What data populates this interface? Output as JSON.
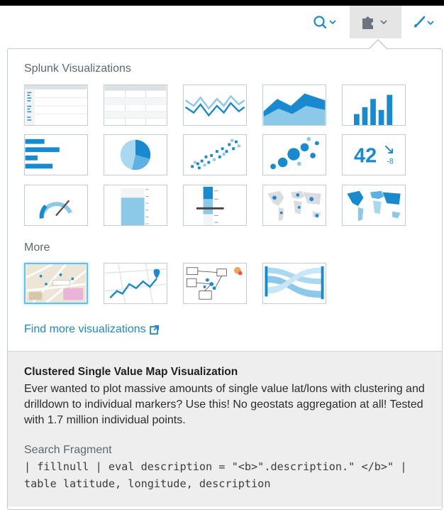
{
  "toolbar": {
    "search_icon": "search-icon",
    "viz_icon": "puzzle-icon",
    "format_icon": "paintbrush-icon",
    "accent": "#1a8ad0"
  },
  "panel": {
    "splunk_section_label": "Splunk Visualizations",
    "more_section_label": "More",
    "splunk_visualizations": [
      "events-viewer",
      "statistics-table",
      "line-chart",
      "area-chart",
      "column-chart",
      "bar-chart",
      "pie-chart",
      "scatter-chart",
      "bubble-chart",
      "single-value",
      "radial-gauge",
      "filler-gauge",
      "marker-gauge",
      "cluster-map",
      "choropleth-map"
    ],
    "single_value": {
      "value": "42",
      "delta": "-8"
    },
    "more_visualizations": [
      "clustered-single-value-map",
      "route-map",
      "network-diagram",
      "sankey-diagram"
    ],
    "find_more_label": "Find more visualizations"
  },
  "description": {
    "title": "Clustered Single Value Map Visualization",
    "body": "Ever wanted to plot massive amounts of single value lat/lons with clustering and drilldown to individual markers? Use this! No geostats aggregation at all! Tested with 1.7 million individual points.",
    "fragment_label": "Search Fragment",
    "fragment_code": "| fillnull | eval description = \"<b>\".description.\" </b>\" | table latitude, longitude, description"
  }
}
